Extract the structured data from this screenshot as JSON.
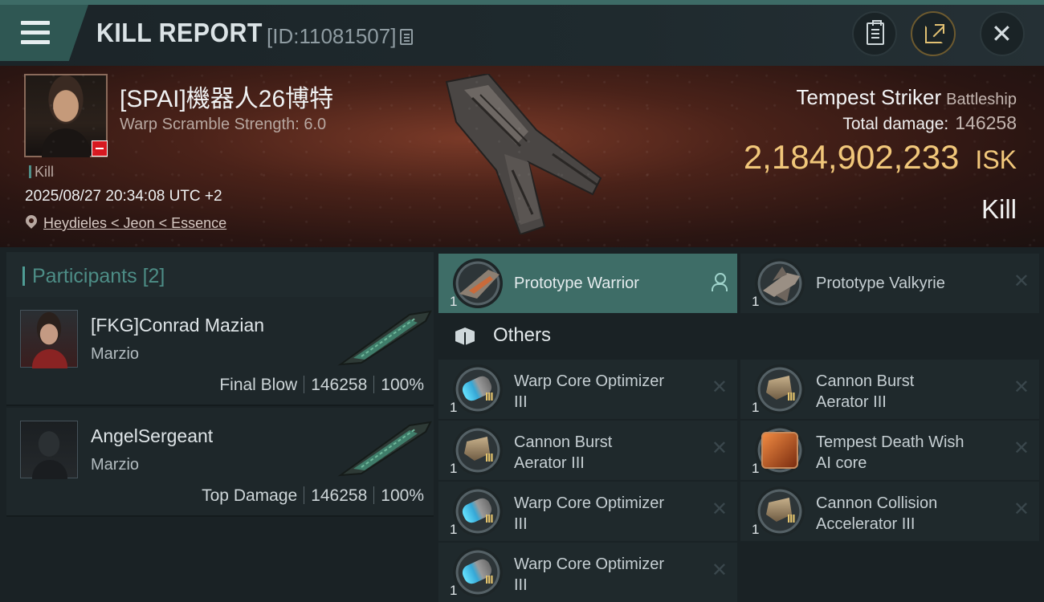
{
  "header": {
    "title": "KILL REPORT",
    "id_text": "[ID:11081507]"
  },
  "victim": {
    "name": "[SPAI]機器人26博特",
    "scramble": "Warp Scramble Strength: 6.0",
    "tag": "Kill",
    "datetime": "2025/08/27 20:34:08 UTC +2",
    "location": "Heydieles < Jeon < Essence",
    "ship_name": "Tempest Striker",
    "ship_class": "Battleship",
    "total_damage_label": "Total damage:",
    "total_damage": "146258",
    "isk_value": "2,184,902,233",
    "isk_unit": "ISK",
    "result": "Kill"
  },
  "participants": {
    "label": "Participants",
    "count": "[2]",
    "items": [
      {
        "name": "[FKG]Conrad Mazian",
        "corp": "Marzio",
        "role": "Final Blow",
        "damage": "146258",
        "percent": "100%"
      },
      {
        "name": "AngelSergeant",
        "corp": "Marzio",
        "role": "Top Damage",
        "damage": "146258",
        "percent": "100%"
      }
    ]
  },
  "ships": [
    {
      "name": "Prototype  Warrior",
      "qty": "1"
    },
    {
      "name": "Prototype  Valkyrie",
      "qty": "1"
    }
  ],
  "others": {
    "label": "Others",
    "items": [
      {
        "line1": "Warp Core Optimizer",
        "line2": "III",
        "qty": "1",
        "tier": "III",
        "icon": "warp-core-optimizer"
      },
      {
        "line1": "Cannon Burst",
        "line2": "Aerator III",
        "qty": "1",
        "tier": "III",
        "icon": "cannon-burst-aerator"
      },
      {
        "line1": "Cannon Burst",
        "line2": "Aerator III",
        "qty": "1",
        "tier": "III",
        "icon": "cannon-burst-aerator"
      },
      {
        "line1": "Tempest Death Wish",
        "line2": "AI core",
        "qty": "1",
        "tier": "",
        "icon": "ai-core"
      },
      {
        "line1": "Warp Core Optimizer",
        "line2": "III",
        "qty": "1",
        "tier": "III",
        "icon": "warp-core-optimizer"
      },
      {
        "line1": "Cannon Collision",
        "line2": "Accelerator III",
        "qty": "1",
        "tier": "III",
        "icon": "cannon-collision-accelerator"
      },
      {
        "line1": "Warp Core Optimizer",
        "line2": "III",
        "qty": "1",
        "tier": "III",
        "icon": "warp-core-optimizer"
      }
    ]
  },
  "colors": {
    "accent": "#3e6d67",
    "isk": "#f1c77a",
    "minus_badge": "#d71920"
  }
}
